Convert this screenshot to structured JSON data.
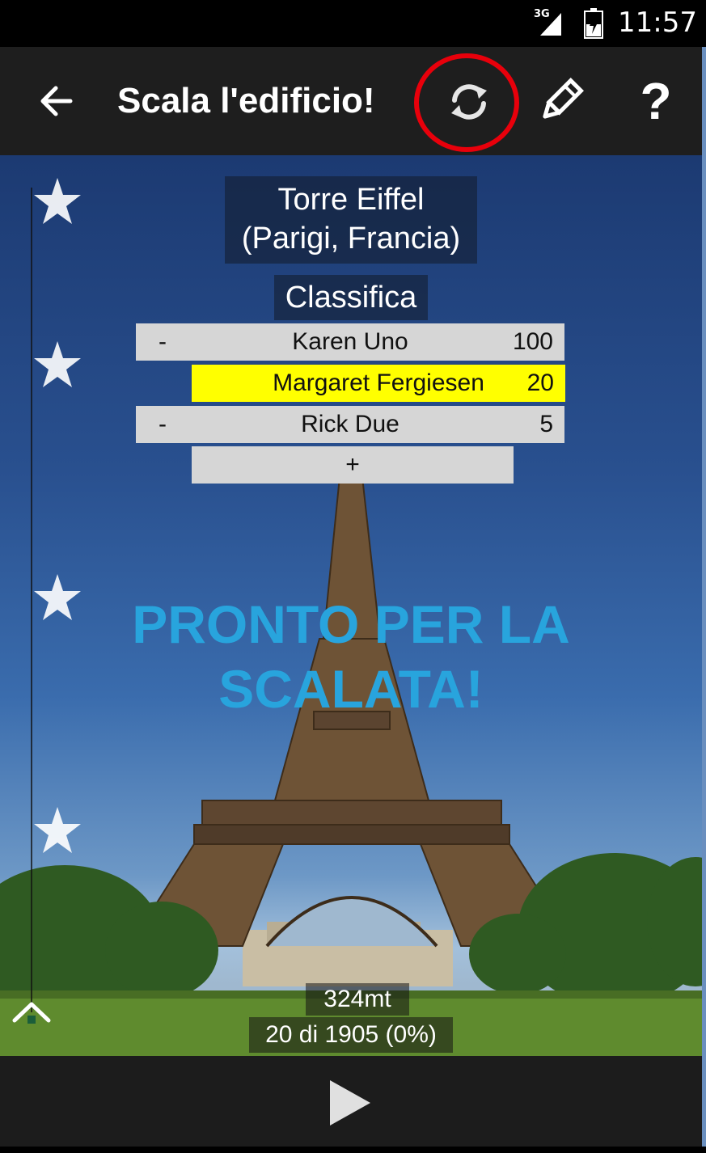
{
  "status_bar": {
    "network": "3G",
    "time": "11:57"
  },
  "toolbar": {
    "title": "Scala l'edificio!",
    "back_icon": "arrow-left-icon",
    "refresh_icon": "refresh-icon",
    "edit_icon": "pencil-icon",
    "help_label": "?"
  },
  "building": {
    "name": "Torre Eiffel",
    "location": "(Parigi, Francia)"
  },
  "leaderboard": {
    "title": "Classifica",
    "rows": [
      {
        "minus": "-",
        "name": "Karen Uno",
        "score": "100",
        "highlight": false
      },
      {
        "minus": "",
        "name": "Margaret Fergiesen",
        "score": "20",
        "highlight": true
      },
      {
        "minus": "-",
        "name": "Rick Due",
        "score": "5",
        "highlight": false
      }
    ],
    "add_label": "+"
  },
  "ready_message": {
    "line1": "PRONTO PER LA",
    "line2": "SCALATA!"
  },
  "climb": {
    "height": "324mt",
    "progress": "20 di 1905 (0%)",
    "progress_fraction": 0.0
  },
  "stars": {
    "count": 4,
    "icon": "star-icon"
  },
  "controls": {
    "play_icon": "play-icon",
    "scroll_up_icon": "chevron-up-icon"
  },
  "colors": {
    "accent": "#28a4dd",
    "highlight_row": "#ffff00",
    "ring": "#e8000b"
  }
}
